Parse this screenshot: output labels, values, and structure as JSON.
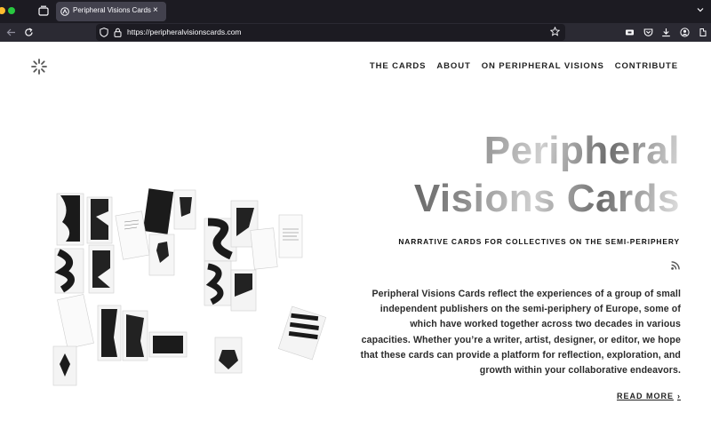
{
  "browser": {
    "tab_title": "Peripheral Visions Cards",
    "close_glyph": "×",
    "url": "https://peripheralvisionscards.com",
    "icons": [
      "tab-overview-icon",
      "favicon-icon",
      "close-icon",
      "tab-list-icon",
      "back-icon",
      "reload-icon",
      "shield-icon",
      "lock-icon",
      "bookmark-star-icon",
      "extension-puzzle-icon",
      "pocket-icon",
      "download-icon",
      "account-icon",
      "menu-icon"
    ]
  },
  "site": {
    "nav": [
      "THE CARDS",
      "ABOUT",
      "ON PERIPHERAL VISIONS",
      "CONTRIBUTE"
    ],
    "title_line1": "Peripheral",
    "title_line2": "Visions Cards",
    "subtitle": "NARRATIVE CARDS FOR COLLECTIVES ON THE SEMI-PERIPHERY",
    "description": "Peripheral Visions Cards reflect the experiences of a group of small independent publishers on the semi-periphery of Europe, some of which have worked together across two decades in various capacities. Whether you’re a writer, artist, designer, or editor, we hope that these cards can provide a platform for reflection, exploration, and growth within your collaborative endeavors.",
    "read_more": "READ MORE",
    "read_more_glyph": "›"
  },
  "colors": {
    "chrome_dark": "#1c1b22",
    "chrome_toolbar": "#2b2a33",
    "tab_active": "#42414d",
    "page_bg": "#ffffff",
    "text": "#222222"
  }
}
